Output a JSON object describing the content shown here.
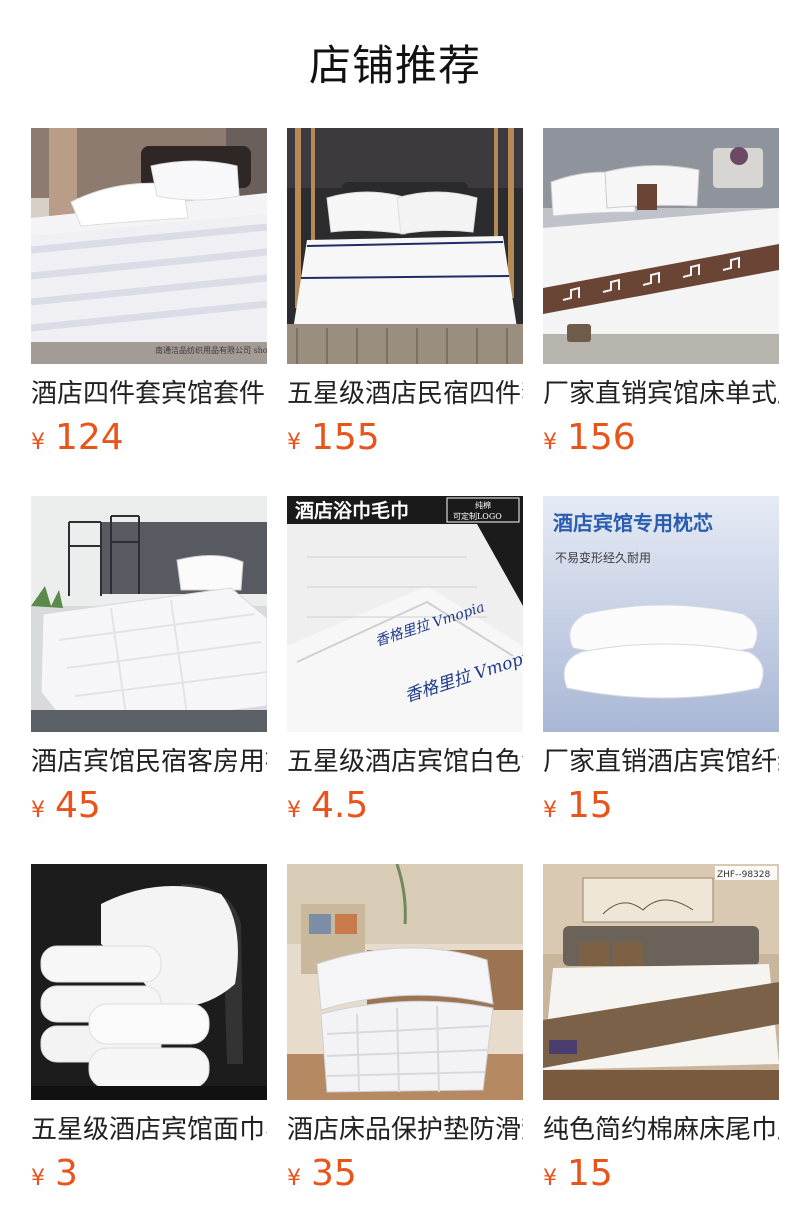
{
  "header": {
    "title": "店铺推荐"
  },
  "colors": {
    "price": "#e8541b",
    "title": "#111111",
    "text": "#222222"
  },
  "products": [
    {
      "name": "酒店四件套宾馆套件",
      "currency": "¥",
      "price": "124",
      "image_icon": "striped-bedding-set-photo",
      "image_text": "南通洁品纺织用品有限公司 shop61176010852252.1688.com"
    },
    {
      "name": "五星级酒店民宿四件套",
      "currency": "¥",
      "price": "155",
      "image_icon": "white-bedding-with-navy-trim-photo"
    },
    {
      "name": "厂家直销宾馆床单式床",
      "currency": "¥",
      "price": "156",
      "image_icon": "bedding-with-greek-key-pattern-photo"
    },
    {
      "name": "酒店宾馆民宿客房用被",
      "currency": "¥",
      "price": "45",
      "image_icon": "white-quilt-on-bed-photo"
    },
    {
      "name": "五星级酒店宾馆白色浴",
      "currency": "¥",
      "price": "4.5",
      "image_icon": "white-hotel-towel-photo",
      "image_text": {
        "banner": "酒店浴巾毛巾",
        "badge_top": "纯棉",
        "badge_bottom": "可定制LOGO",
        "embroidery": "香格里拉 Vmopia"
      }
    },
    {
      "name": "厂家直销酒店宾馆纤维",
      "currency": "¥",
      "price": "15",
      "image_icon": "pillows-photo",
      "image_text": {
        "headline": "酒店宾馆专用枕芯",
        "subline": "不易变形经久耐用"
      }
    },
    {
      "name": "五星级酒店宾馆面巾毛",
      "currency": "¥",
      "price": "3",
      "image_icon": "stacked-white-towels-photo"
    },
    {
      "name": "酒店床品保护垫防滑垫",
      "currency": "¥",
      "price": "35",
      "image_icon": "quilted-mattress-pad-photo"
    },
    {
      "name": "纯色简约棉麻床尾巾床",
      "currency": "¥",
      "price": "15",
      "image_icon": "bed-runner-photo",
      "image_text": "ZHF--98328"
    }
  ]
}
